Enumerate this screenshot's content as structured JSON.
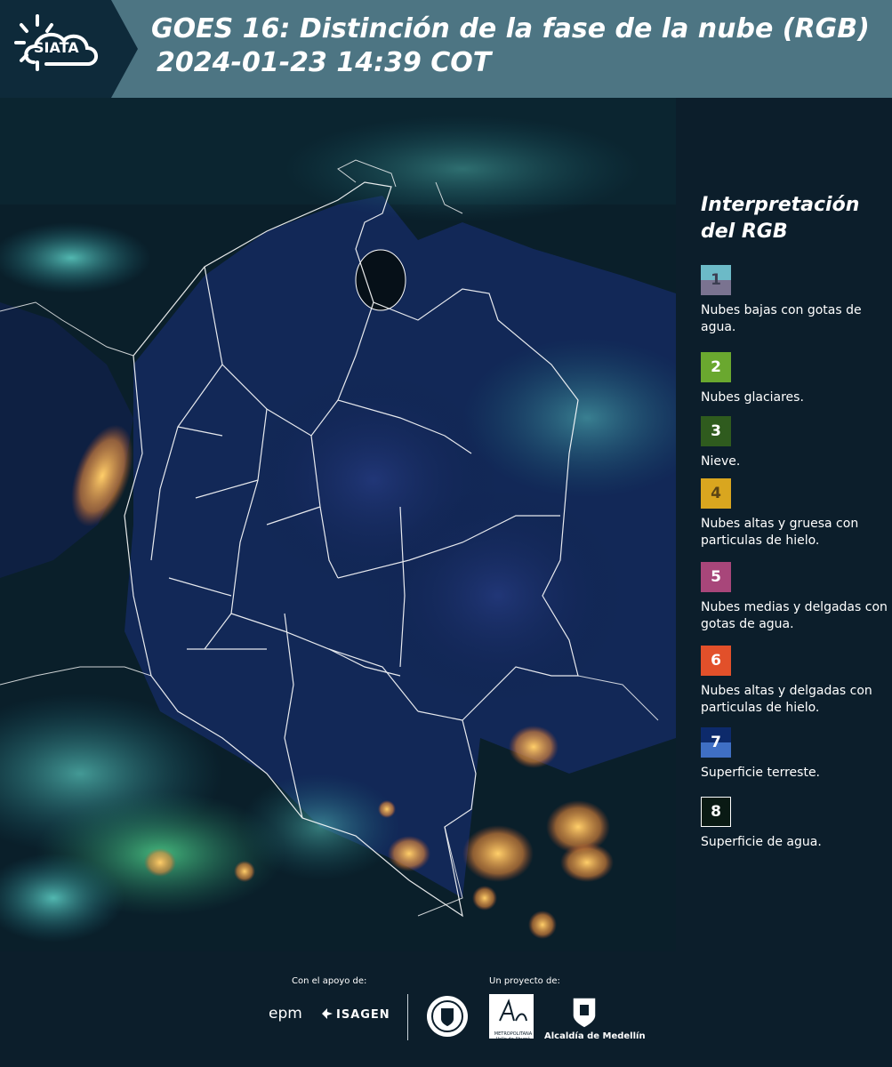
{
  "header": {
    "logo_text": "SIATA",
    "title_line1": "GOES 16: Distinción de la fase de la nube (RGB)",
    "title_line2": "2024-01-23 14:39 COT"
  },
  "legend": {
    "title_line1": "Interpretación",
    "title_line2": "del RGB",
    "items": [
      {
        "number": "1",
        "label": "Nubes bajas con gotas de agua.",
        "color": "#6cbac7",
        "color2": "#7a7390"
      },
      {
        "number": "2",
        "label": "Nubes glaciares.",
        "color": "#6aa82f"
      },
      {
        "number": "3",
        "label": "Nieve.",
        "color": "#2f5b1e"
      },
      {
        "number": "4",
        "label": "Nubes altas y gruesa con particulas de hielo.",
        "color": "#d9a61f"
      },
      {
        "number": "5",
        "label": "Nubes medias y delgadas con gotas de agua.",
        "color": "#a8467a"
      },
      {
        "number": "6",
        "label": "Nubes altas y delgadas con particulas de hielo.",
        "color": "#e2502a"
      },
      {
        "number": "7",
        "label": "Superficie terreste.",
        "color": "#0d2a6b",
        "color2": "#3f6fc4"
      },
      {
        "number": "8",
        "label": "Superficie de agua.",
        "color": "#0a1a14"
      }
    ]
  },
  "footer": {
    "support_label": "Con el apoyo de:",
    "project_label": "Un proyecto de:",
    "epm": "epm",
    "isagen": "ISAGEN",
    "area_metro_name": "METROPOLITANA",
    "area_metro_sub": "Valle de Aburrá",
    "alcaldia": "Alcaldía de Medellín"
  }
}
